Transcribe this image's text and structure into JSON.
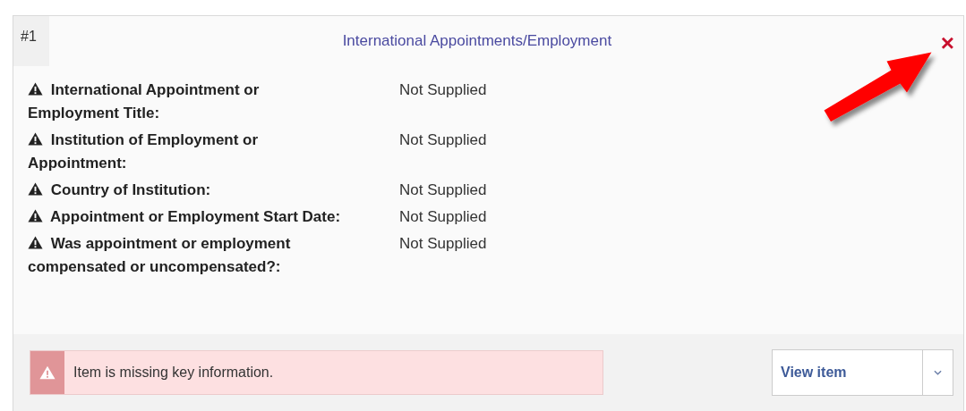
{
  "card": {
    "number": "#1",
    "title": "International Appointments/Employment",
    "close": "×"
  },
  "fields": [
    {
      "label": "International Appointment or Employment Title:",
      "value": "Not Supplied",
      "warning": true
    },
    {
      "label": "Institution of Employment or Appointment:",
      "value": "Not Supplied",
      "warning": true
    },
    {
      "label": "Country of Institution:",
      "value": "Not Supplied",
      "warning": true
    },
    {
      "label": "Appointment or Employment Start Date:",
      "value": "Not Supplied",
      "warning": true
    },
    {
      "label": "Was appointment or employment compensated or uncompensated?:",
      "value": "Not Supplied",
      "warning": true
    }
  ],
  "alert": {
    "message": "Item is missing key information."
  },
  "action": {
    "label": "View item"
  }
}
